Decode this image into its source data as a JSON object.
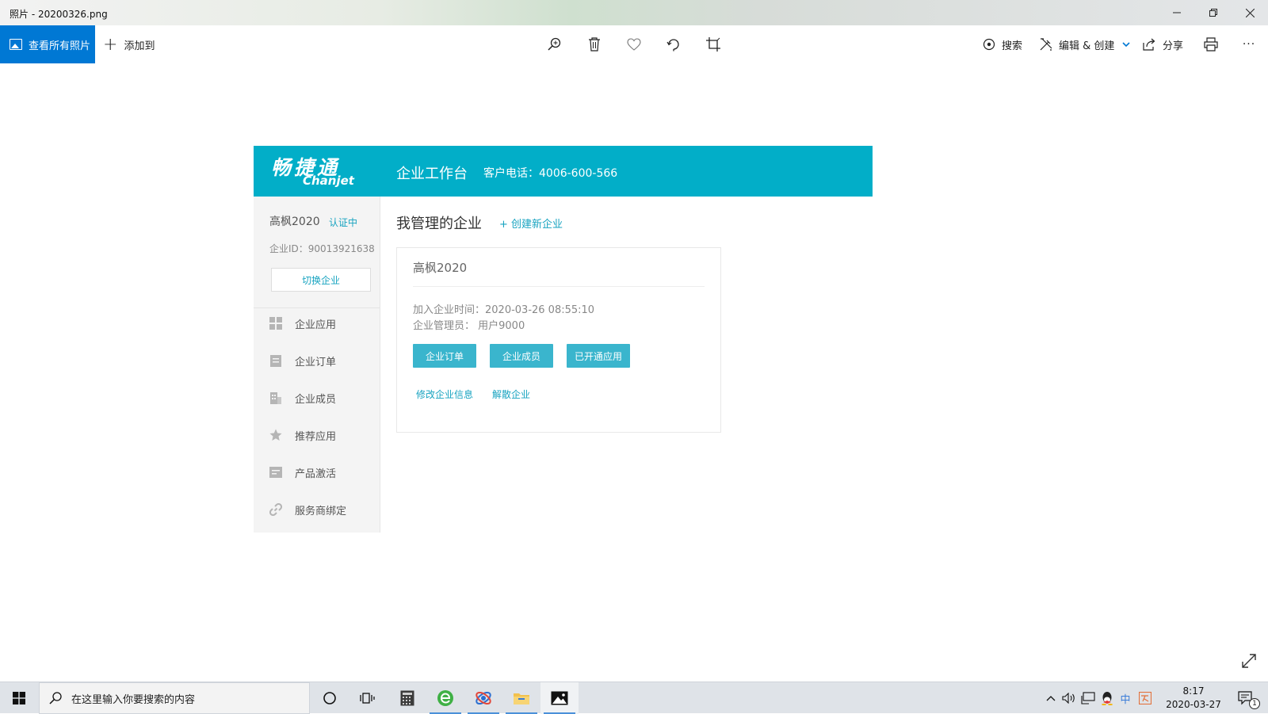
{
  "window": {
    "title": "照片 - 20200326.png",
    "controls": [
      "minimize",
      "restore",
      "close"
    ]
  },
  "toolbar": {
    "view_all_label": "查看所有照片",
    "add_to_label": "添加到",
    "center_icons": [
      "zoom-icon",
      "delete-icon",
      "heart-icon",
      "rotate-icon",
      "crop-icon"
    ],
    "search_label": "搜索",
    "edit_label": "编辑 & 创建",
    "share_label": "分享",
    "more_label": "···"
  },
  "photo": {
    "banner": {
      "logo_cn": "畅捷通",
      "logo_en": "Chanjet",
      "title": "企业工作台",
      "phone": "客户电话：4006-600-566"
    },
    "sidebar": {
      "company": "高枫2020",
      "cert_status": "认证中",
      "enterprise_id": "企业ID：90013921638",
      "switch_label": "切换企业",
      "nav": [
        {
          "label": "企业应用",
          "icon": "grid-icon"
        },
        {
          "label": "企业订单",
          "icon": "order-icon"
        },
        {
          "label": "企业成员",
          "icon": "building-icon"
        },
        {
          "label": "推荐应用",
          "icon": "star-icon"
        },
        {
          "label": "产品激活",
          "icon": "card-icon"
        },
        {
          "label": "服务商绑定",
          "icon": "link-icon"
        }
      ]
    },
    "main": {
      "title": "我管理的企业",
      "create_label": "+ 创建新企业",
      "card": {
        "name": "高枫2020",
        "join_time": "加入企业时间：2020-03-26 08:55:10",
        "admin": "企业管理员：  用户9000",
        "buttons": [
          "企业订单",
          "企业成员",
          "已开通应用"
        ],
        "links": [
          "修改企业信息",
          "解散企业"
        ]
      }
    }
  },
  "taskbar": {
    "search_placeholder": "在这里输入你要搜索的内容",
    "apps": [
      "cortana-icon",
      "task-view-icon",
      "calculator-icon",
      "browser-icon",
      "app-icon",
      "file-explorer-icon",
      "photos-icon"
    ],
    "tray_ime": "中",
    "time": "8:17",
    "date": "2020-03-27",
    "notification_count": "1"
  }
}
